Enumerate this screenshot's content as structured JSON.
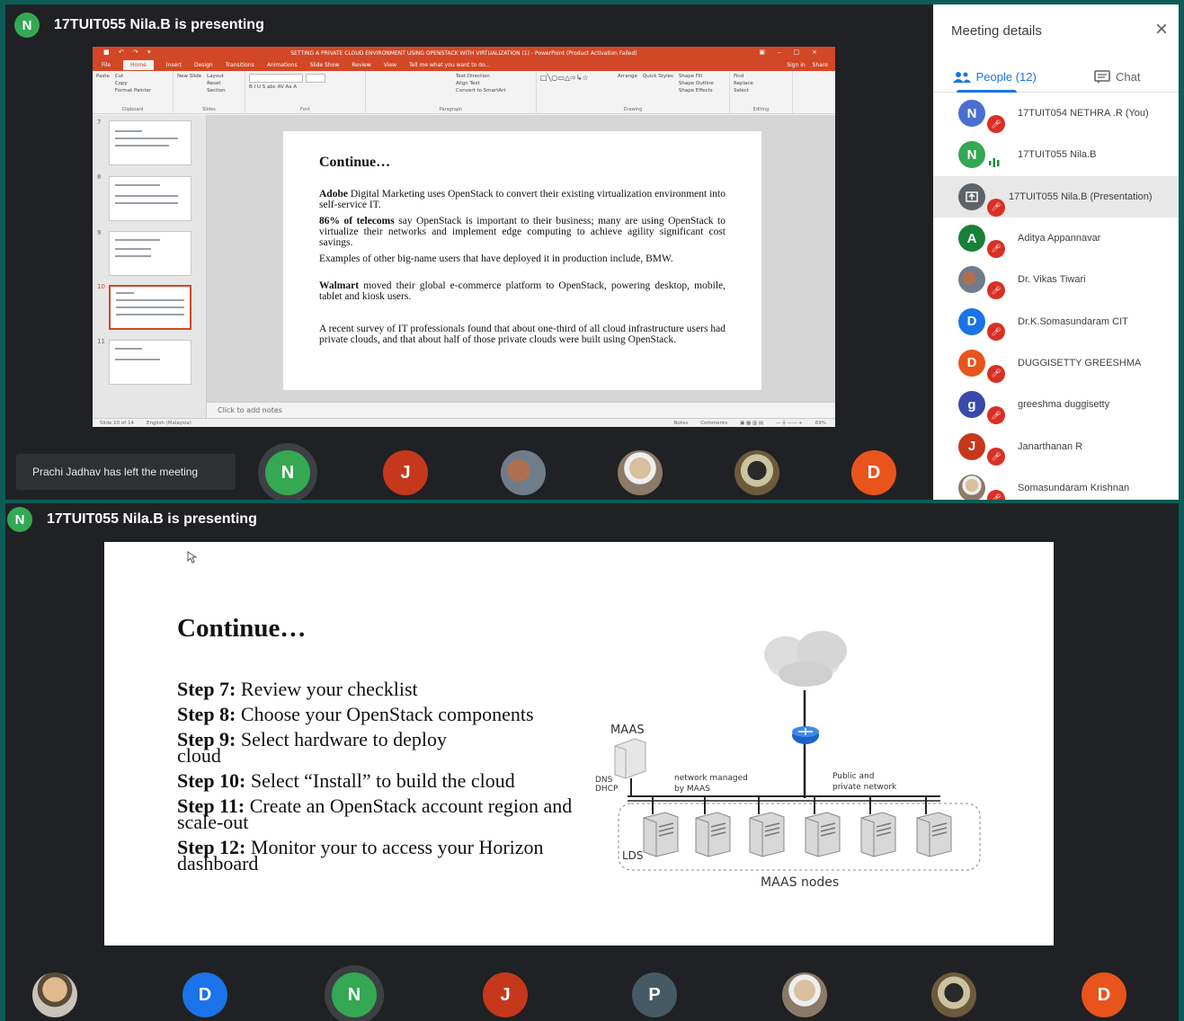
{
  "colors": {
    "accent": "#1a73e8",
    "ppt_red": "#d24726",
    "mute_red": "#d93025",
    "meet_bg": "#202124",
    "frame": "#0c5c55"
  },
  "top": {
    "presenter": {
      "initial": "N",
      "text": "17TUIT055 Nila.B is presenting",
      "avatar_color": "#34a853"
    },
    "ppt": {
      "title": "SETTING A  PRIVATE CLOUD ENVIRONMENT USING OPENSTACK WITH VIRTUALIZATION (1) - PowerPoint (Product Activation Failed)",
      "tabs": [
        "File",
        "Home",
        "Insert",
        "Design",
        "Transitions",
        "Animations",
        "Slide Show",
        "Review",
        "View",
        "Tell me what you want to do..."
      ],
      "right_actions": [
        "Sign in",
        "Share"
      ],
      "ribbon": {
        "clipboard": [
          "Paste",
          "Cut",
          "Copy",
          "Format Painter",
          "Clipboard"
        ],
        "slides": [
          "New Slide",
          "Layout",
          "Reset",
          "Section",
          "Slides"
        ],
        "font": "Font",
        "paragraph": [
          "Text Direction",
          "Align Text",
          "Convert to SmartArt",
          "Paragraph"
        ],
        "drawing": [
          "Arrange",
          "Quick Styles",
          "Shape Fill",
          "Shape Outline",
          "Shape Effects",
          "Drawing"
        ],
        "editing": [
          "Find",
          "Replace",
          "Select",
          "Editing"
        ]
      },
      "thumb_numbers": [
        "7",
        "8",
        "9",
        "10",
        "11"
      ],
      "slide_title": "Continue…",
      "slide_paragraphs": [
        {
          "bold": "Adobe",
          "text": " Digital Marketing uses OpenStack to convert their existing virtualization environment into self-service IT."
        },
        {
          "bold": "86% of telecoms",
          "text": " say OpenStack is important to their business; many are using OpenStack to virtualize their networks and implement edge computing to achieve agility significant cost savings."
        },
        {
          "bold": "",
          "text": "Examples of other big-name users that have deployed it in production include, BMW."
        },
        {
          "bold": "Walmart",
          "text": " moved their global e-commerce platform to OpenStack, powering desktop, mobile, tablet and kiosk users."
        },
        {
          "bold": "",
          "text": "A recent survey of IT professionals found that about one-third of all cloud infrastructure users had private clouds, and that about half of those private clouds were built using OpenStack."
        }
      ],
      "notes_placeholder": "Click to add notes",
      "status": {
        "slide": "Slide 10 of 14",
        "language": "English (Malaysia)",
        "notes": "Notes",
        "comments": "Comments",
        "zoom": "69%"
      }
    },
    "toast": "Prachi Jadhav has left the meeting",
    "strip_tiles": [
      {
        "initial": "N",
        "color": "#34a853",
        "ring": true
      },
      {
        "initial": "J",
        "color": "#c5381c",
        "ring": false
      },
      {
        "initial": "",
        "color": "#b07050",
        "ring": false,
        "photo": "photo4"
      },
      {
        "initial": "",
        "color": "#d8c09f",
        "ring": false,
        "photo": "photo2"
      },
      {
        "initial": "",
        "color": "#cbc3a0",
        "ring": false,
        "photo": "photo3"
      },
      {
        "initial": "D",
        "color": "#e8541b",
        "ring": false
      }
    ]
  },
  "details": {
    "title": "Meeting details",
    "tabs": {
      "people": "People (12)",
      "chat": "Chat"
    },
    "participants": [
      {
        "initial": "N",
        "name": "17TUIT054 NETHRA .R (You)",
        "color": "#4a6fd0",
        "state": "muted"
      },
      {
        "initial": "N",
        "name": "17TUIT055 Nila.B",
        "color": "#34a853",
        "state": "speaking"
      },
      {
        "initial": "",
        "name": "17TUIT055 Nila.B (Presentation)",
        "color": "#5f6368",
        "state": "muted",
        "presentation": true
      },
      {
        "initial": "A",
        "name": "Aditya Appannavar",
        "color": "#188038",
        "state": "muted"
      },
      {
        "initial": "",
        "name": "Dr. Vikas Tiwari",
        "color": "#b07050",
        "state": "muted",
        "photo": "photo4"
      },
      {
        "initial": "D",
        "name": "Dr.K.Somasundaram CIT",
        "color": "#1a73e8",
        "state": "muted"
      },
      {
        "initial": "D",
        "name": "DUGGISETTY GREESHMA",
        "color": "#e8541b",
        "state": "muted"
      },
      {
        "initial": "g",
        "name": "greeshma duggisetty",
        "color": "#3949ab",
        "state": "muted"
      },
      {
        "initial": "J",
        "name": "Janarthanan R",
        "color": "#c5381c",
        "state": "muted"
      },
      {
        "initial": "",
        "name": "Somasundaram Krishnan",
        "color": "#d8c09f",
        "state": "muted",
        "photo": "photo2"
      }
    ]
  },
  "bottom": {
    "presenter": {
      "initial": "N",
      "text": "17TUIT055 Nila.B is presenting",
      "avatar_color": "#34a853"
    },
    "slide_title": "Continue…",
    "steps": [
      {
        "label": "Step 7:",
        "text": " Review your checklist"
      },
      {
        "label": "Step 8:",
        "text": " Choose your OpenStack components"
      },
      {
        "label": "Step 9:",
        "text": " Select hardware to deploy  cloud"
      },
      {
        "label": "Step 10:",
        "text": " Select “Install” to build the cloud"
      },
      {
        "label": "Step 11:",
        "text": " Create an OpenStack account region and scale-out"
      },
      {
        "label": "Step 12:",
        "text": " Monitor your to access your Horizon dashboard"
      }
    ],
    "diagram": {
      "maas": "MAAS",
      "dns": "DNS",
      "dhcp": "DHCP",
      "network_managed": "network managed",
      "by_maas": "by MAAS",
      "public_and": "Public and",
      "private_network": "private network",
      "lds": "LDS",
      "nodes": "MAAS nodes"
    },
    "strip_tiles": [
      {
        "initial": "",
        "color": "#b07050",
        "photo": "photo"
      },
      {
        "initial": "D",
        "color": "#1a73e8"
      },
      {
        "initial": "N",
        "color": "#34a853",
        "ring": true
      },
      {
        "initial": "J",
        "color": "#c5381c"
      },
      {
        "initial": "P",
        "color": "#455a64"
      },
      {
        "initial": "",
        "color": "#d8c09f",
        "photo": "photo2"
      },
      {
        "initial": "",
        "color": "#cbc3a0",
        "photo": "photo3"
      },
      {
        "initial": "D",
        "color": "#e8541b"
      }
    ]
  }
}
